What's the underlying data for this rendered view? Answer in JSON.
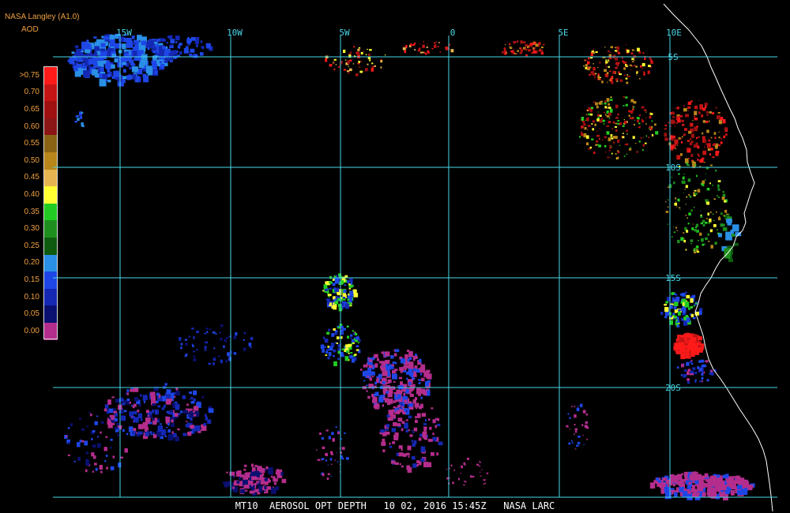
{
  "header": {
    "title": "NASA Langley (A1.0)",
    "unit": "AOD"
  },
  "legend": {
    "labels": [
      ">0.75",
      "0.70",
      "0.65",
      "0.60",
      "0.55",
      "0.50",
      "0.45",
      "0.40",
      "0.35",
      "0.30",
      "0.25",
      "0.20",
      "0.15",
      "0.10",
      "0.05",
      "0.00"
    ],
    "colors": [
      "#ff1a1a",
      "#c41414",
      "#a01010",
      "#8a1616",
      "#8a6414",
      "#b8861a",
      "#e6b450",
      "#ffff33",
      "#22cc22",
      "#1e8f1e",
      "#0e5a0e",
      "#2a8fe6",
      "#1e46e6",
      "#1428b4",
      "#0a1070",
      "#b42d8c"
    ]
  },
  "grid": {
    "longitudes": [
      "15W",
      "10W",
      "5W",
      "0",
      "5E",
      "10E"
    ],
    "latitudes": [
      "5S",
      "10S",
      "15S",
      "20S"
    ],
    "color": "#48d8e8"
  },
  "footer": {
    "text": "MT10  AEROSOL OPT DEPTH   10 02, 2016 15:45Z   NASA LARC"
  },
  "colors": {
    "background": "#000000",
    "label": "#f0a040",
    "coastline": "#ffffff",
    "grid": "#48d8e8"
  }
}
